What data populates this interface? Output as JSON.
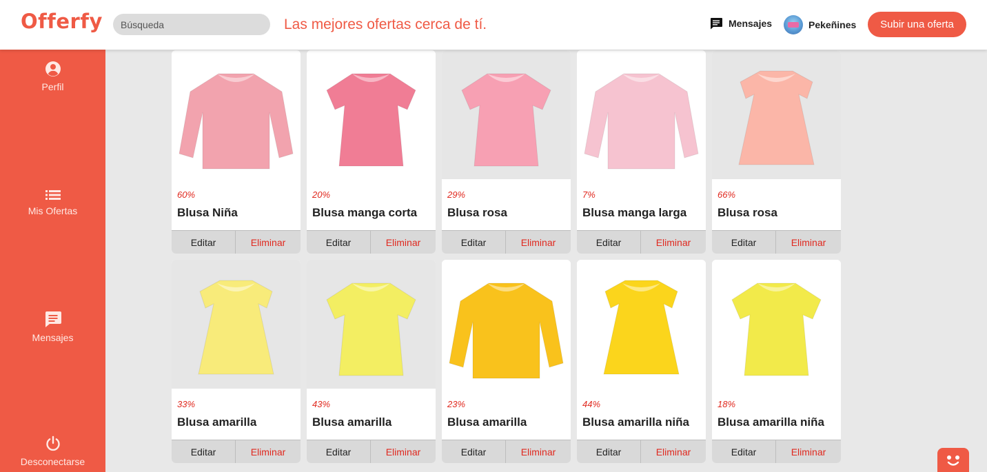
{
  "header": {
    "logo": "Offerfy",
    "search_placeholder": "Búsqueda",
    "tagline": "Las mejores ofertas cerca de tí.",
    "messages_label": "Mensajes",
    "user_name": "Pekeñines",
    "upload_label": "Subir una oferta"
  },
  "sidebar": {
    "items": [
      {
        "label": "Perfil",
        "icon": "user-circle-icon"
      },
      {
        "label": "Mis Ofertas",
        "icon": "list-icon"
      },
      {
        "label": "Mensajes",
        "icon": "message-icon"
      },
      {
        "label": "Desconectarse",
        "icon": "power-icon"
      }
    ]
  },
  "offers": [
    {
      "discount": "60%",
      "title": "Blusa Niña",
      "edit": "Editar",
      "delete": "Eliminar",
      "color": "#f2a3ae",
      "bg": "#ffffff",
      "style": "long"
    },
    {
      "discount": "20%",
      "title": "Blusa manga corta",
      "edit": "Editar",
      "delete": "Eliminar",
      "color": "#f07d95",
      "bg": "#ffffff",
      "style": "short"
    },
    {
      "discount": "29%",
      "title": "Blusa rosa",
      "edit": "Editar",
      "delete": "Eliminar",
      "color": "#f7a0b3",
      "bg": "#e6e6e6",
      "style": "short"
    },
    {
      "discount": "7%",
      "title": "Blusa manga larga",
      "edit": "Editar",
      "delete": "Eliminar",
      "color": "#f6c3d0",
      "bg": "#ffffff",
      "style": "long"
    },
    {
      "discount": "66%",
      "title": "Blusa rosa",
      "edit": "Editar",
      "delete": "Eliminar",
      "color": "#fbb6a8",
      "bg": "#e6e6e6",
      "style": "dress"
    },
    {
      "discount": "33%",
      "title": "Blusa amarilla",
      "edit": "Editar",
      "delete": "Eliminar",
      "color": "#f8eb7a",
      "bg": "#e6e6e6",
      "style": "dress"
    },
    {
      "discount": "43%",
      "title": "Blusa amarilla",
      "edit": "Editar",
      "delete": "Eliminar",
      "color": "#f3ee62",
      "bg": "#e6e6e6",
      "style": "short"
    },
    {
      "discount": "23%",
      "title": "Blusa amarilla",
      "edit": "Editar",
      "delete": "Eliminar",
      "color": "#f9c21c",
      "bg": "#ffffff",
      "style": "long"
    },
    {
      "discount": "44%",
      "title": "Blusa amarilla niña",
      "edit": "Editar",
      "delete": "Eliminar",
      "color": "#fbd51c",
      "bg": "#ffffff",
      "style": "dress"
    },
    {
      "discount": "18%",
      "title": "Blusa amarilla niña",
      "edit": "Editar",
      "delete": "Eliminar",
      "color": "#f2ea4a",
      "bg": "#ffffff",
      "style": "short"
    }
  ],
  "colors": {
    "brand": "#ef5a45",
    "discount": "#e0281e",
    "button_bg": "#d9d9d9"
  }
}
